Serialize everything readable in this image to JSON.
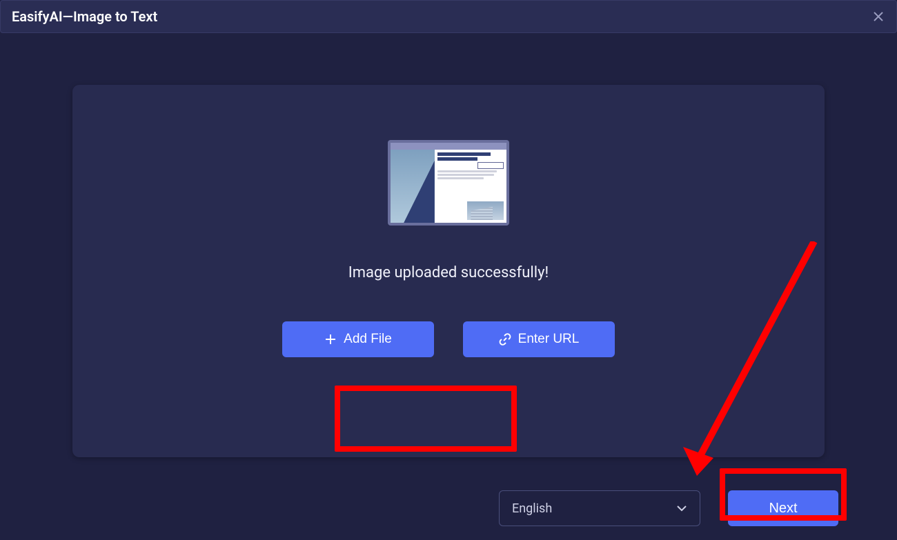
{
  "titlebar": {
    "title": "EasifyAI—Image to Text"
  },
  "main": {
    "status_message": "Image uploaded successfully!",
    "add_file_label": "Add File",
    "enter_url_label": "Enter URL"
  },
  "footer": {
    "language_selected": "English",
    "next_label": "Next"
  }
}
